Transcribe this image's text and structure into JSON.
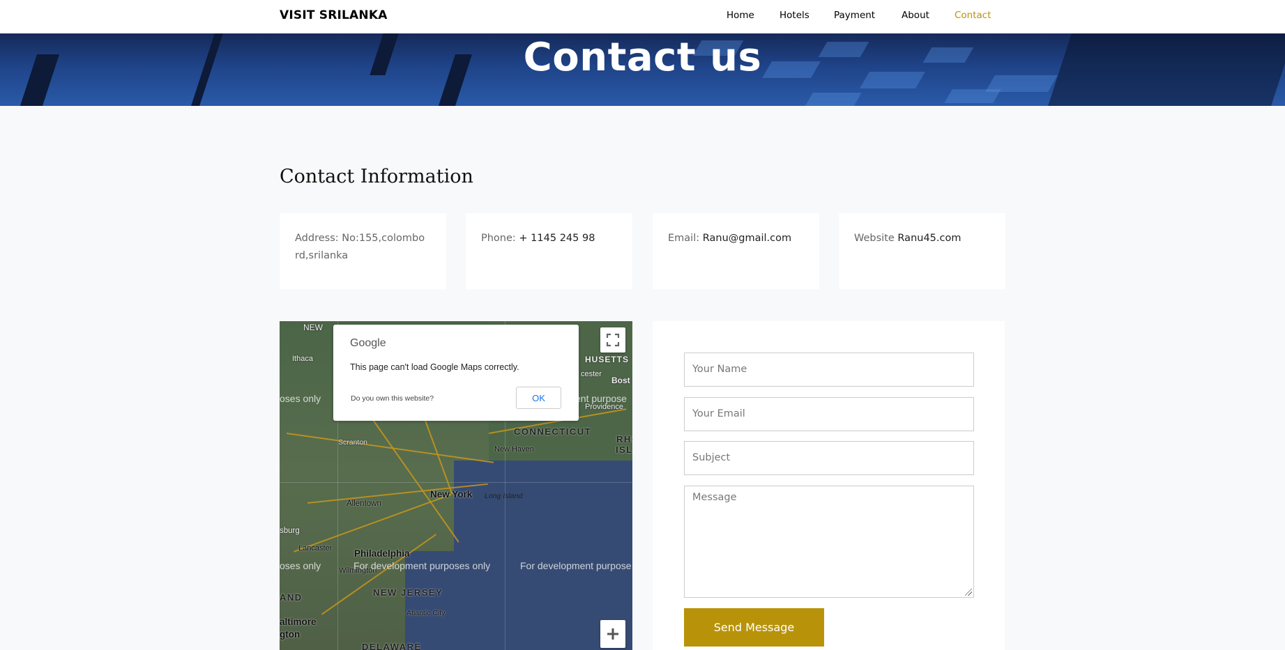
{
  "nav": {
    "brand": "VISIT SRILANKA",
    "links": [
      {
        "label": "Home"
      },
      {
        "label": "Hotels"
      },
      {
        "label": "Payment"
      },
      {
        "label": "About"
      },
      {
        "label": "Contact",
        "active": true
      }
    ]
  },
  "hero": {
    "title": "Contact us"
  },
  "contact": {
    "heading": "Contact Information",
    "cards": [
      {
        "label": "Address: No:155,colombo rd,srilanka",
        "value": ""
      },
      {
        "label": "Phone: ",
        "value": "+ 1145 245 98"
      },
      {
        "label": "Email: ",
        "value": "Ranu@gmail.com"
      },
      {
        "label": "Website ",
        "value": "Ranu45.com"
      }
    ]
  },
  "map": {
    "dialog": {
      "logo": "Google",
      "message": "This page can't load Google Maps correctly.",
      "own_site": "Do you own this website?",
      "ok": "OK"
    },
    "labels": {
      "new": "NEW",
      "ithaca": "Ithaca",
      "husetts": "HUSETTS",
      "chester": "cester",
      "boston": "Bost",
      "providence": "Providence",
      "connecticut": "CONNECTICUT",
      "rhode": "RHODE",
      "island": "ISLAND",
      "scranton": "Scranton",
      "new_haven": "New Haven",
      "new_york": "New York",
      "long_island": "Long Island",
      "allentown": "Allentown",
      "burg": "sburg",
      "lancaster": "Lancaster",
      "philadelphia": "Philadelphia",
      "wilmington": "Wilmington",
      "new_jersey": "NEW JERSEY",
      "atlantic_city": "Atlantic City",
      "land": "AND",
      "baltimore": "altimore",
      "ington": "gton",
      "delaware": "DELAWARE",
      "dev_left_top": "oses only",
      "dev_right_top": "ent purpose",
      "dev_left_bottom": "oses only",
      "dev_mid_bottom": "For development purposes only",
      "dev_right_bottom": "For development purpose"
    },
    "fullscreen_icon": "fullscreen-icon",
    "zoom_in_icon": "plus-icon"
  },
  "form": {
    "name_placeholder": "Your Name",
    "email_placeholder": "Your Email",
    "subject_placeholder": "Subject",
    "message_placeholder": "Message",
    "submit": "Send Message"
  },
  "colors": {
    "accent": "#b8930a",
    "nav_active": "#b8930a",
    "hero_blue": "#1f4388",
    "page_bg": "#f8f9fa"
  }
}
